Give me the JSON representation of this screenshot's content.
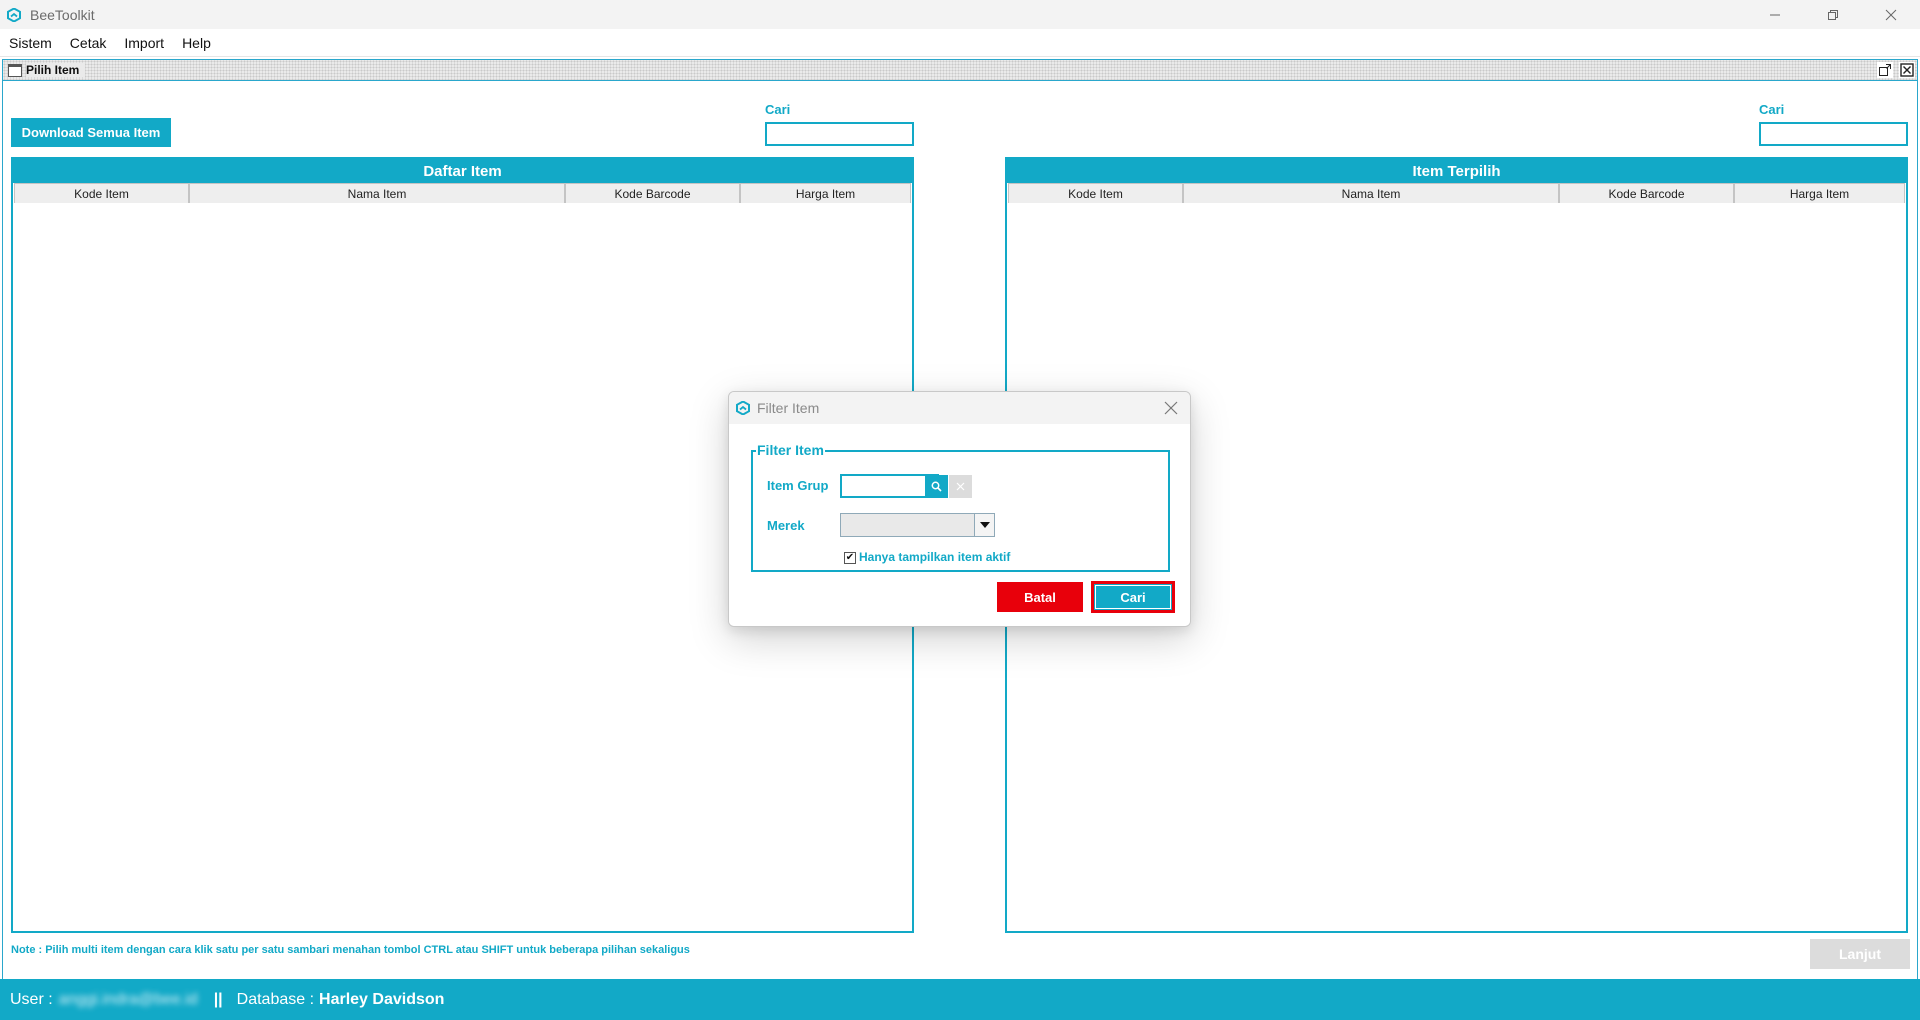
{
  "window": {
    "title": "BeeToolkit",
    "controls": [
      "minimize-icon",
      "restore-icon",
      "close-icon"
    ]
  },
  "menu": {
    "items": [
      "Sistem",
      "Cetak",
      "Import",
      "Help"
    ]
  },
  "frame": {
    "title": "Pilih Item",
    "download_button": "Download Semua Item",
    "left_search_label": "Cari",
    "right_search_label": "Cari",
    "left_search_value": "",
    "right_search_value": "",
    "left_panel": {
      "title": "Daftar Item",
      "columns": [
        "Kode Item",
        "Nama Item",
        "Kode Barcode",
        "Harga Item"
      ],
      "rows": []
    },
    "right_panel": {
      "title": "Item Terpilih",
      "columns": [
        "Kode Item",
        "Nama Item",
        "Kode Barcode",
        "Harga Item"
      ],
      "rows": []
    },
    "note": "Note : Pilih multi item dengan cara klik satu per satu sambari menahan tombol CTRL atau SHIFT untuk beberapa pilihan sekaligus",
    "next_button": "Lanjut"
  },
  "status": {
    "user_label": "User :",
    "user_value": "anggi.indra@bee.id",
    "separator": "||",
    "database_label": "Database :",
    "database_value": "Harley Davidson"
  },
  "dialog": {
    "title": "Filter Item",
    "group_title": "Filter Item",
    "item_group_label": "Item Grup",
    "item_group_value": "",
    "brand_label": "Merek",
    "brand_value": "",
    "active_only_label": "Hanya tampilkan item aktif",
    "active_only_checked": true,
    "check_mark": "✔",
    "cancel_button": "Batal",
    "search_button": "Cari"
  },
  "colors": {
    "accent": "#12a9c7",
    "danger": "#e8000b",
    "disabled": "#dcdcdc"
  }
}
